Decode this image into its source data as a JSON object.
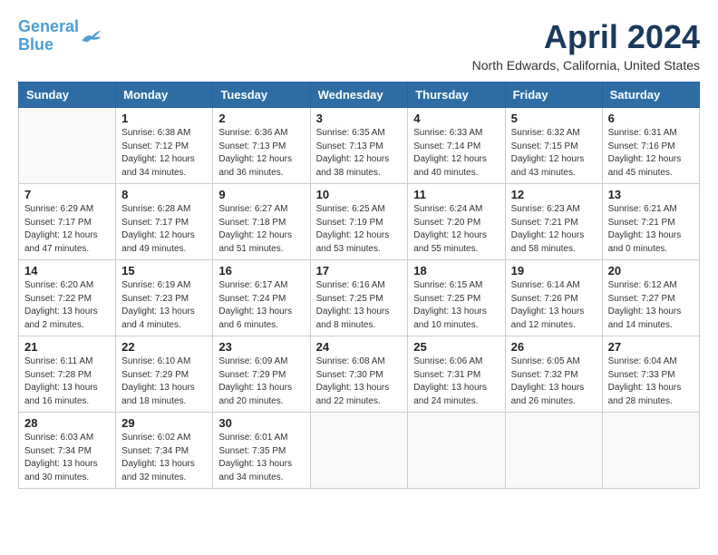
{
  "header": {
    "logo_line1": "General",
    "logo_line2": "Blue",
    "month_title": "April 2024",
    "location": "North Edwards, California, United States"
  },
  "weekdays": [
    "Sunday",
    "Monday",
    "Tuesday",
    "Wednesday",
    "Thursday",
    "Friday",
    "Saturday"
  ],
  "weeks": [
    [
      {
        "day": "",
        "info": ""
      },
      {
        "day": "1",
        "info": "Sunrise: 6:38 AM\nSunset: 7:12 PM\nDaylight: 12 hours\nand 34 minutes."
      },
      {
        "day": "2",
        "info": "Sunrise: 6:36 AM\nSunset: 7:13 PM\nDaylight: 12 hours\nand 36 minutes."
      },
      {
        "day": "3",
        "info": "Sunrise: 6:35 AM\nSunset: 7:13 PM\nDaylight: 12 hours\nand 38 minutes."
      },
      {
        "day": "4",
        "info": "Sunrise: 6:33 AM\nSunset: 7:14 PM\nDaylight: 12 hours\nand 40 minutes."
      },
      {
        "day": "5",
        "info": "Sunrise: 6:32 AM\nSunset: 7:15 PM\nDaylight: 12 hours\nand 43 minutes."
      },
      {
        "day": "6",
        "info": "Sunrise: 6:31 AM\nSunset: 7:16 PM\nDaylight: 12 hours\nand 45 minutes."
      }
    ],
    [
      {
        "day": "7",
        "info": "Sunrise: 6:29 AM\nSunset: 7:17 PM\nDaylight: 12 hours\nand 47 minutes."
      },
      {
        "day": "8",
        "info": "Sunrise: 6:28 AM\nSunset: 7:17 PM\nDaylight: 12 hours\nand 49 minutes."
      },
      {
        "day": "9",
        "info": "Sunrise: 6:27 AM\nSunset: 7:18 PM\nDaylight: 12 hours\nand 51 minutes."
      },
      {
        "day": "10",
        "info": "Sunrise: 6:25 AM\nSunset: 7:19 PM\nDaylight: 12 hours\nand 53 minutes."
      },
      {
        "day": "11",
        "info": "Sunrise: 6:24 AM\nSunset: 7:20 PM\nDaylight: 12 hours\nand 55 minutes."
      },
      {
        "day": "12",
        "info": "Sunrise: 6:23 AM\nSunset: 7:21 PM\nDaylight: 12 hours\nand 58 minutes."
      },
      {
        "day": "13",
        "info": "Sunrise: 6:21 AM\nSunset: 7:21 PM\nDaylight: 13 hours\nand 0 minutes."
      }
    ],
    [
      {
        "day": "14",
        "info": "Sunrise: 6:20 AM\nSunset: 7:22 PM\nDaylight: 13 hours\nand 2 minutes."
      },
      {
        "day": "15",
        "info": "Sunrise: 6:19 AM\nSunset: 7:23 PM\nDaylight: 13 hours\nand 4 minutes."
      },
      {
        "day": "16",
        "info": "Sunrise: 6:17 AM\nSunset: 7:24 PM\nDaylight: 13 hours\nand 6 minutes."
      },
      {
        "day": "17",
        "info": "Sunrise: 6:16 AM\nSunset: 7:25 PM\nDaylight: 13 hours\nand 8 minutes."
      },
      {
        "day": "18",
        "info": "Sunrise: 6:15 AM\nSunset: 7:25 PM\nDaylight: 13 hours\nand 10 minutes."
      },
      {
        "day": "19",
        "info": "Sunrise: 6:14 AM\nSunset: 7:26 PM\nDaylight: 13 hours\nand 12 minutes."
      },
      {
        "day": "20",
        "info": "Sunrise: 6:12 AM\nSunset: 7:27 PM\nDaylight: 13 hours\nand 14 minutes."
      }
    ],
    [
      {
        "day": "21",
        "info": "Sunrise: 6:11 AM\nSunset: 7:28 PM\nDaylight: 13 hours\nand 16 minutes."
      },
      {
        "day": "22",
        "info": "Sunrise: 6:10 AM\nSunset: 7:29 PM\nDaylight: 13 hours\nand 18 minutes."
      },
      {
        "day": "23",
        "info": "Sunrise: 6:09 AM\nSunset: 7:29 PM\nDaylight: 13 hours\nand 20 minutes."
      },
      {
        "day": "24",
        "info": "Sunrise: 6:08 AM\nSunset: 7:30 PM\nDaylight: 13 hours\nand 22 minutes."
      },
      {
        "day": "25",
        "info": "Sunrise: 6:06 AM\nSunset: 7:31 PM\nDaylight: 13 hours\nand 24 minutes."
      },
      {
        "day": "26",
        "info": "Sunrise: 6:05 AM\nSunset: 7:32 PM\nDaylight: 13 hours\nand 26 minutes."
      },
      {
        "day": "27",
        "info": "Sunrise: 6:04 AM\nSunset: 7:33 PM\nDaylight: 13 hours\nand 28 minutes."
      }
    ],
    [
      {
        "day": "28",
        "info": "Sunrise: 6:03 AM\nSunset: 7:34 PM\nDaylight: 13 hours\nand 30 minutes."
      },
      {
        "day": "29",
        "info": "Sunrise: 6:02 AM\nSunset: 7:34 PM\nDaylight: 13 hours\nand 32 minutes."
      },
      {
        "day": "30",
        "info": "Sunrise: 6:01 AM\nSunset: 7:35 PM\nDaylight: 13 hours\nand 34 minutes."
      },
      {
        "day": "",
        "info": ""
      },
      {
        "day": "",
        "info": ""
      },
      {
        "day": "",
        "info": ""
      },
      {
        "day": "",
        "info": ""
      }
    ]
  ]
}
